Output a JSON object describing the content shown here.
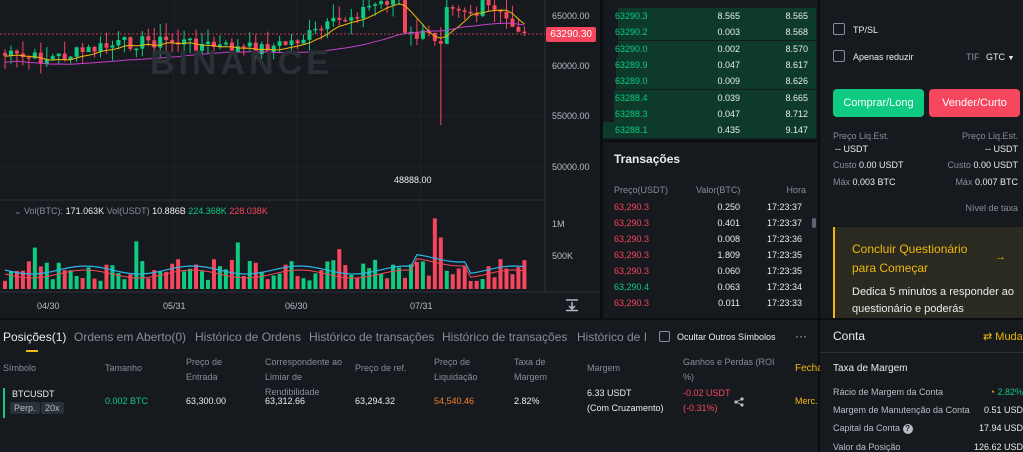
{
  "chart": {
    "watermark": "BINANCE",
    "current_price": "63290.30",
    "low_marker": "48888.00",
    "price_axis": [
      "65000.00",
      "60000.00",
      "55000.00",
      "50000.00"
    ],
    "volume_axis": [
      "1M",
      "500K"
    ],
    "dates": [
      "04/30",
      "05/31",
      "06/30",
      "07/31"
    ],
    "volume_legend": {
      "prefix": "Vol(BTC):",
      "btc": "171.063K",
      "usdt_label": "Vol(USDT)",
      "usdt": "10.886B",
      "green": "224.368K",
      "red": "228.038K"
    },
    "colors": {
      "up": "#0ecb81",
      "down": "#f6465d",
      "ma_fast": "#f0b90b",
      "ma_slow": "#c63ec9",
      "vol_ma": "#2fb4e8"
    }
  },
  "orderbook": {
    "rows": [
      {
        "price": "63290.3",
        "qty": "8.565",
        "total": "8.565",
        "depth": 0.93
      },
      {
        "price": "63290.2",
        "qty": "0.003",
        "total": "8.568",
        "depth": 0.93
      },
      {
        "price": "63290.0",
        "qty": "0.002",
        "total": "8.570",
        "depth": 0.93
      },
      {
        "price": "63289.9",
        "qty": "0.047",
        "total": "8.617",
        "depth": 0.94
      },
      {
        "price": "63289.0",
        "qty": "0.009",
        "total": "8.626",
        "depth": 0.94
      },
      {
        "price": "63288.4",
        "qty": "0.039",
        "total": "8.665",
        "depth": 0.95
      },
      {
        "price": "63288.3",
        "qty": "0.047",
        "total": "8.712",
        "depth": 0.95
      },
      {
        "price": "63288.1",
        "qty": "0.435",
        "total": "9.147",
        "depth": 1.0
      }
    ]
  },
  "trades": {
    "title": "Transações",
    "headers": {
      "price": "Preço(USDT)",
      "qty": "Valor(BTC)",
      "time": "Hora"
    },
    "rows": [
      {
        "price": "63,290.3",
        "qty": "0.250",
        "time": "17:23:37",
        "side": "sell"
      },
      {
        "price": "63,290.3",
        "qty": "0.401",
        "time": "17:23:37",
        "side": "sell"
      },
      {
        "price": "63,290.3",
        "qty": "0.008",
        "time": "17:23:36",
        "side": "sell"
      },
      {
        "price": "63,290.3",
        "qty": "1.809",
        "time": "17:23:35",
        "side": "sell"
      },
      {
        "price": "63,290.3",
        "qty": "0.060",
        "time": "17:23:35",
        "side": "sell"
      },
      {
        "price": "63,290.4",
        "qty": "0.063",
        "time": "17:23:34",
        "side": "buy"
      },
      {
        "price": "63,290.3",
        "qty": "0.011",
        "time": "17:23:33",
        "side": "sell"
      }
    ]
  },
  "order_panel": {
    "tpsl": "TP/SL",
    "reduce_only": "Apenas reduzir",
    "tif_label": "TIF",
    "tif_value": "GTC",
    "buy_label": "Comprar/Long",
    "sell_label": "Vender/Curto",
    "buy_info": {
      "liq_label": "Preço Liq.Est.",
      "liq_value": "-- USDT",
      "cost_label": "Custo",
      "cost_value": "0.00 USDT",
      "max_label": "Máx",
      "max_value": "0.003 BTC"
    },
    "sell_info": {
      "liq_label": "Preço Liq.Est.",
      "liq_value": "-- USDT",
      "cost_label": "Custo",
      "cost_value": "0.00 USDT",
      "max_label": "Máx",
      "max_value": "0.007 BTC"
    },
    "fee_level": "Nível de taxa",
    "quiz": {
      "title": "Concluir Questionário para Começar",
      "body": "Dedica 5 minutos a responder ao questionário e poderás"
    }
  },
  "positions": {
    "tabs": [
      "Posições(1)",
      "Ordens em Aberto(0)",
      "Histórico de Ordens",
      "Histórico de transações",
      "Histórico de transações",
      "Histórico de I"
    ],
    "hide_others": "Ocultar Outros Símbolos",
    "more": "···",
    "columns": {
      "symbol": "Símbolo",
      "size": "Tamanho",
      "entry": "Preço de Entrada",
      "breakeven": "Correspondente ao Limiar de Rendibilidade",
      "ref": "Preço de ref.",
      "liq": "Preço de Liquidação",
      "margin_rate": "Taxa de Margem",
      "margin": "Margem",
      "pnl": "Ganhos e Perdas (ROI %)",
      "close": "Fecha"
    },
    "row": {
      "symbol": "BTCUSDT",
      "type": "Perp.",
      "leverage": "20x",
      "size": "0.002 BTC",
      "entry": "63,300.00",
      "breakeven": "63,312.66",
      "ref": "63,294.32",
      "liq": "54,540.46",
      "margin_rate": "2.82%",
      "margin": "6.33 USDT",
      "margin_mode": "(Com Cruzamento)",
      "pnl": "-0.02 USDT",
      "roi": "(-0.31%)",
      "close": "Merc."
    }
  },
  "account": {
    "title": "Conta",
    "switch_label": "Mudar",
    "section": "Taxa de Margem",
    "rows": [
      {
        "label": "Rácio de Margem da Conta",
        "value": "2.82%"
      },
      {
        "label": "Margem de Manutenção da Conta",
        "value": "0.51 USD"
      },
      {
        "label": "Capital da Conta",
        "value": "17.94 USD"
      },
      {
        "label": "Valor da Posição",
        "value": "126.62 USD"
      }
    ]
  }
}
